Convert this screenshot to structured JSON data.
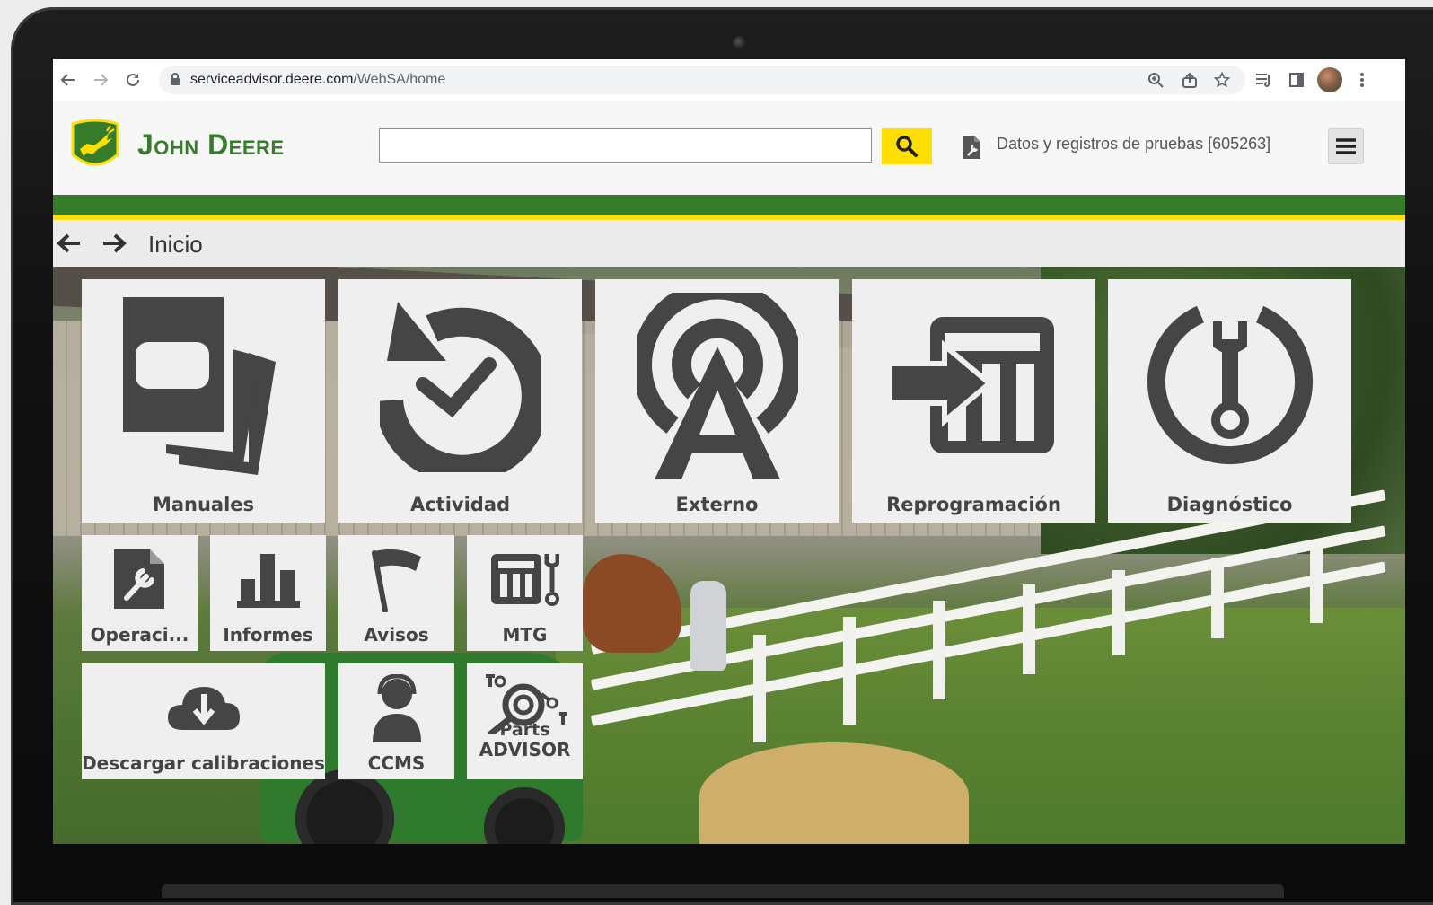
{
  "browser": {
    "url_domain": "serviceadvisor.deere.com",
    "url_path": "/WebSA/home"
  },
  "header": {
    "brand": "John Deere",
    "search": {
      "value": "",
      "placeholder": ""
    },
    "record": "Datos y registros de pruebas [605263]"
  },
  "breadcrumb": {
    "title": "Inicio"
  },
  "tiles": {
    "manuales": "Manuales",
    "actividad": "Actividad",
    "externo": "Externo",
    "reprogramacion": "Reprogramación",
    "diagnostico": "Diagnóstico",
    "operaciones": "Operaci...",
    "informes": "Informes",
    "avisos": "Avisos",
    "mtg": "MTG",
    "descargar": "Descargar calibraciones",
    "ccms": "CCMS",
    "parts_line1": "Parts",
    "parts_line2": "ADVISOR"
  },
  "colors": {
    "brand_green": "#367c2b",
    "brand_yellow": "#ffde00",
    "tile_bg": "#efefef",
    "icon_gray": "#454545"
  }
}
